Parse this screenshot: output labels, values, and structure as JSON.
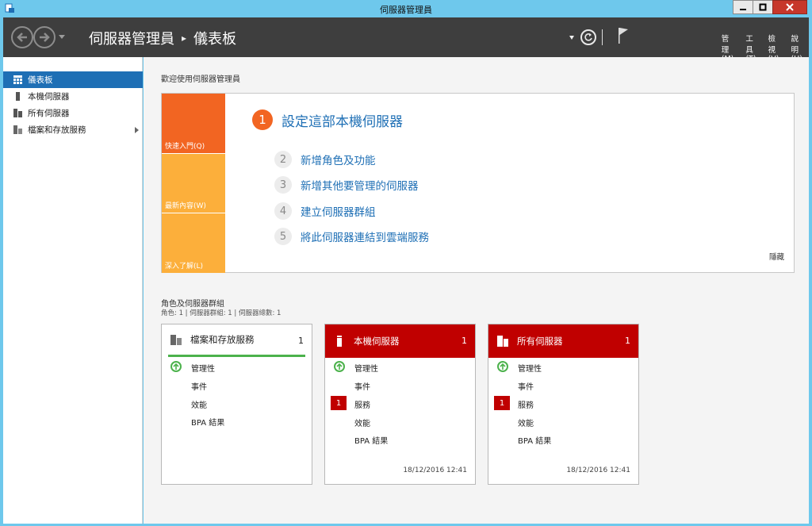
{
  "window": {
    "title": "伺服器管理員"
  },
  "breadcrumb": {
    "root": "伺服器管理員",
    "current": "儀表板"
  },
  "menu": {
    "manage": "管理(M)",
    "tools": "工具(T)",
    "view": "檢視(V)",
    "help": "說明(H)"
  },
  "sidebar": {
    "items": [
      {
        "label": "儀表板",
        "selected": true
      },
      {
        "label": "本機伺服器"
      },
      {
        "label": "所有伺服器"
      },
      {
        "label": "檔案和存放服務"
      }
    ]
  },
  "welcome": {
    "title": "歡迎使用伺服器管理員"
  },
  "quickstart": {
    "tabs": [
      "快速入門(Q)",
      "最新內容(W)",
      "深入了解(L)"
    ],
    "steps": [
      {
        "num": "1",
        "label": "設定這部本機伺服器"
      },
      {
        "num": "2",
        "label": "新增角色及功能"
      },
      {
        "num": "3",
        "label": "新增其他要管理的伺服器"
      },
      {
        "num": "4",
        "label": "建立伺服器群組"
      },
      {
        "num": "5",
        "label": "將此伺服器連結到雲端服務"
      }
    ],
    "hide": "隱藏"
  },
  "roles": {
    "title": "角色及伺服器群組",
    "summary": "角色: 1 | 伺服器群組: 1 | 伺服器總數: 1",
    "tiles": [
      {
        "title": "檔案和存放服務",
        "count": "1",
        "rows": [
          "管理性",
          "事件",
          "效能",
          "BPA 結果"
        ],
        "timestamp": ""
      },
      {
        "title": "本機伺服器",
        "count": "1",
        "rows": [
          "管理性",
          "事件",
          "服務",
          "效能",
          "BPA 結果"
        ],
        "service_badge": "1",
        "timestamp": "18/12/2016 12:41"
      },
      {
        "title": "所有伺服器",
        "count": "1",
        "rows": [
          "管理性",
          "事件",
          "服務",
          "效能",
          "BPA 結果"
        ],
        "service_badge": "1",
        "timestamp": "18/12/2016 12:41"
      }
    ]
  },
  "colors": {
    "accent": "#1e6fb5",
    "orange": "#f26522",
    "lightorange": "#fcaf3b",
    "alert": "#c00000",
    "ok": "#4cb24c",
    "toolbar": "#3e3e3e"
  }
}
